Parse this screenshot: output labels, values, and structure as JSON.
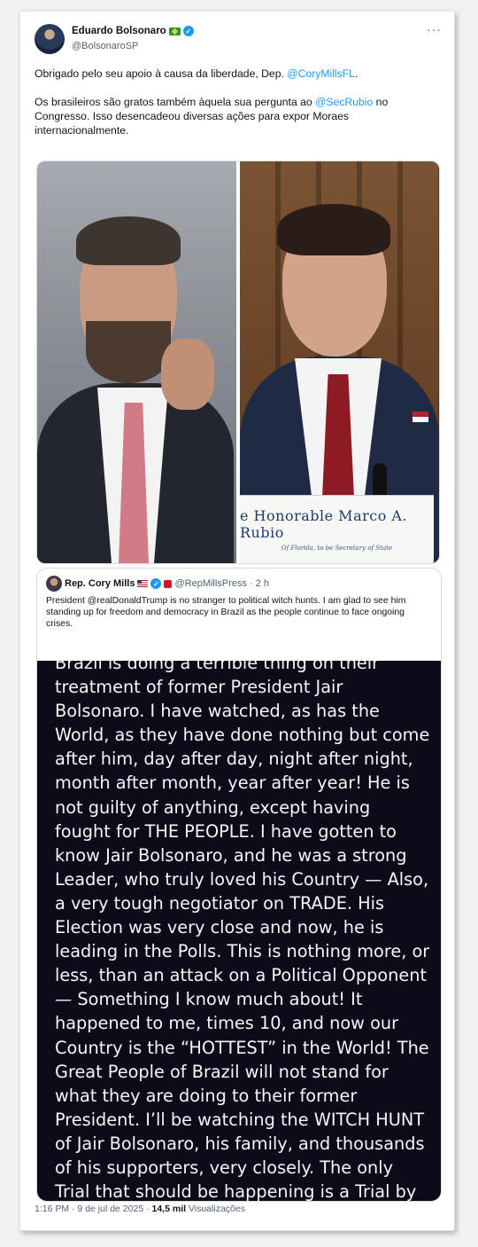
{
  "author": {
    "name": "Eduardo Bolsonaro",
    "handle": "@BolsonaroSP",
    "flag_icon": "brazil-flag-icon",
    "verified_icon": "verified-badge-icon"
  },
  "more_label": "···",
  "tweet": {
    "p1_before": "Obrigado pelo seu apoio à causa da liberdade, Dep. ",
    "p1_mention": "@CoryMillsFL",
    "p1_after": ".",
    "p2_before": "Os brasileiros são gratos também àquela sua pergunta ao ",
    "p2_mention": "@SecRubio",
    "p2_after": " no Congresso. Isso desencadeou diversas ações para expor Moraes internacionalmente."
  },
  "photos": {
    "nameplate_title": "e Honorable Marco A. Rubio",
    "nameplate_sub": "Of Florida, to be Secretary of State"
  },
  "quote": {
    "name": "Rep. Cory Mills",
    "handle": "@RepMillsPress",
    "time": "· 2 h",
    "text": "President @realDonaldTrump is no stranger to political witch hunts. I am glad to see him standing up for freedom and democracy in Brazil as the people continue to face ongoing crises.",
    "image_text": "Brazil is doing a terrible thing on their treatment of former President Jair Bolsonaro. I have watched, as has the World, as they have done nothing but come after him, day after day, night after night, month after month, year after year! He is not guilty of anything, except having fought for THE PEOPLE. I have gotten to know Jair Bolsonaro, and he was a strong Leader, who truly loved his Country — Also, a very tough negotiator on TRADE. His Election was very close and now, he is leading in the Polls. This is nothing more, or less, than an attack on a Political Opponent — Something I know much about! It happened to me, times 10, and now our Country is the “HOTTEST” in the World! The Great People of Brazil will not stand for what they are doing to their former President. I’ll be watching the WITCH HUNT of Jair Bolsonaro, his family, and thousands of his supporters, very closely. The only Trial that should be happening is a Trial by the Voters of Brazil — It’s called an Election."
  },
  "meta": {
    "time_date": "1:16 PM · 9 de jul de 2025 · ",
    "views_count": "14,5 mil",
    "views_label": " Visualizações"
  },
  "colors": {
    "accent": "#1d9bf0",
    "text": "#0f1419",
    "secondary": "#536471",
    "quote_image_bg": "#0d0b1a"
  }
}
